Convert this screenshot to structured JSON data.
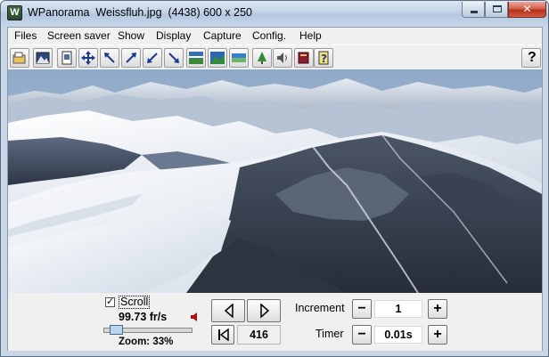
{
  "window": {
    "title": "WPanorama  Weissfluh.jpg  (4438) 600 x 250",
    "app_icon_glyph": "W"
  },
  "menu": [
    "Files",
    "Screen saver",
    "Show",
    "Display",
    "Capture",
    "Config.",
    "Help"
  ],
  "toolbar": {
    "buttons": [
      "open-icon",
      "picture-icon",
      "page-icon",
      "move-icon",
      "arrow-left-up-icon",
      "arrow-up-right-icon",
      "arrow-down-left-icon",
      "arrow-down-right-icon",
      "landscape-a-icon",
      "landscape-b-icon",
      "landscape-c-icon",
      "tree-icon",
      "sound-icon",
      "book-icon",
      "help-page-icon"
    ],
    "help_label": "?"
  },
  "controls": {
    "scroll_checked": true,
    "scroll_label": "Scroll",
    "fps": "99.73 fr/s",
    "zoom": "Zoom: 33%",
    "zoom_level": 0.33,
    "frame": "416",
    "increment_label": "Increment",
    "increment_value": "1",
    "timer_label": "Timer",
    "timer_value": "0.01s",
    "minus": "−",
    "plus": "+"
  },
  "colors": {
    "sky": "#9ab3d0",
    "snow": "#eef2f7",
    "rock": "#3a4556"
  }
}
